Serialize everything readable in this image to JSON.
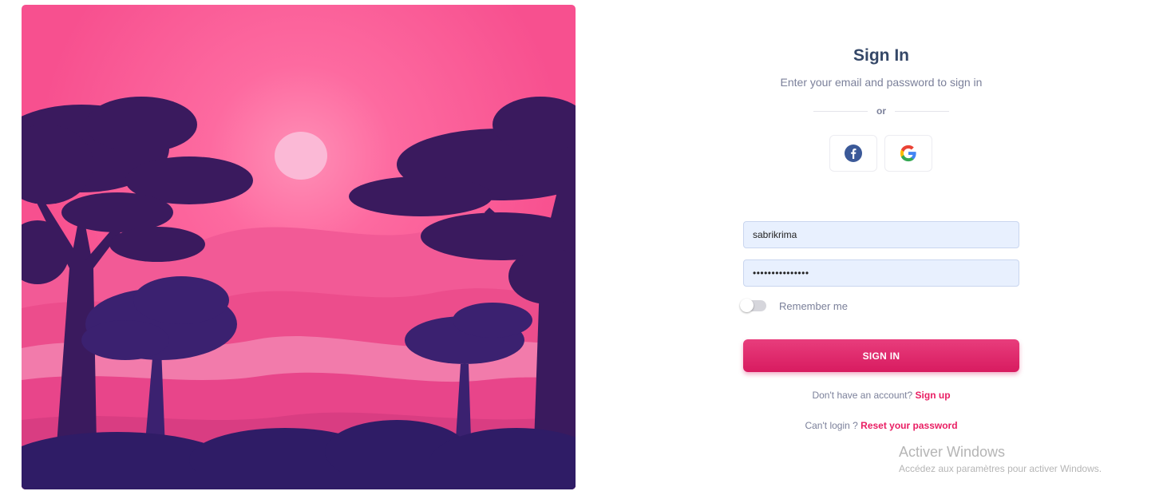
{
  "signin": {
    "title": "Sign In",
    "subtitle": "Enter your email and password to sign in",
    "divider_text": "or",
    "social": [
      {
        "icon": "facebook-icon",
        "color": "#3b5998"
      },
      {
        "icon": "google-icon",
        "colors": [
          "#ea4335",
          "#fbbc05",
          "#34a853",
          "#4285f4"
        ]
      }
    ],
    "username_value": "sabrikrima",
    "password_value": "•••••••••••••••",
    "remember_label": "Remember me",
    "remember_checked": false,
    "submit_label": "SIGN IN",
    "signup_prompt": "Don't have an account?",
    "signup_link": "Sign up",
    "reset_prompt": "Can't login ?",
    "reset_link": "Reset your password"
  },
  "illustration": {
    "subject": "pink sunset landscape with purple tree silhouettes",
    "colors": {
      "sky_top": "#f75e96",
      "sky_glow": "#ff83ae",
      "sun": "#fbb8d5",
      "hills": "#f0609a",
      "trees": "#36185a"
    }
  },
  "watermark": {
    "title": "Activer Windows",
    "subtitle": "Accédez aux paramètres pour activer Windows."
  },
  "theme": {
    "accent": "#e91e63",
    "heading": "#344767",
    "muted": "#7b809a",
    "input_bg": "#e8f0fe"
  }
}
